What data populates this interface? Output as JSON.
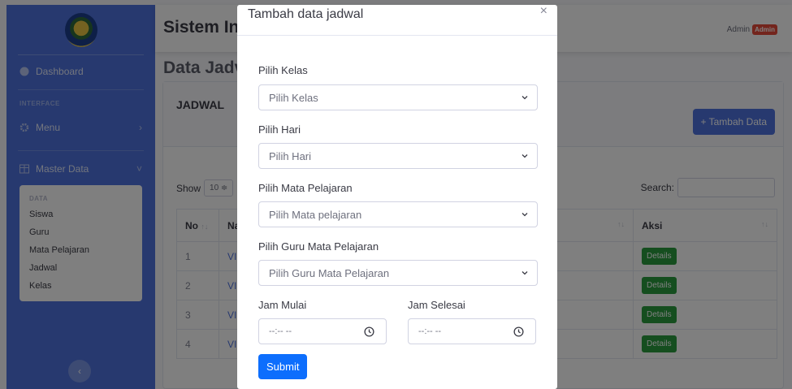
{
  "sidebar": {
    "items": {
      "dashboard": "Dashboard",
      "interface_heading": "INTERFACE",
      "menu": "Menu",
      "master_data": "Master Data",
      "submenu_heading": "DATA",
      "siswa": "Siswa",
      "guru": "Guru",
      "mata_pelajaran": "Mata Pelajaran",
      "jadwal": "Jadwal",
      "kelas": "Kelas"
    },
    "toggle": "‹"
  },
  "topbar": {
    "title": "Sistem In",
    "user": "Admin",
    "badge": "Admin"
  },
  "page": {
    "title": "Data Jadv",
    "card_title": "JADWAL",
    "add_button": "+ Tambah Data",
    "show_label": "Show",
    "show_value": "10 ≑",
    "search_label": "Search:"
  },
  "table": {
    "headers": {
      "no": "No",
      "nama": "Na",
      "aksi": "Aksi"
    },
    "sort_icon": "↑↓",
    "rows": [
      {
        "no": "1",
        "nama": "VI",
        "aksi": "Details"
      },
      {
        "no": "2",
        "nama": "VI",
        "aksi": "Details"
      },
      {
        "no": "3",
        "nama": "VI",
        "aksi": "Details"
      },
      {
        "no": "4",
        "nama": "VI",
        "aksi": "Details"
      }
    ]
  },
  "modal": {
    "title": "Tambah data jadwal",
    "close": "×",
    "fields": {
      "kelas_label": "Pilih Kelas",
      "kelas_placeholder": "Pilih Kelas",
      "hari_label": "Pilih Hari",
      "hari_placeholder": "Pilih Hari",
      "mapel_label": "Pilih Mata Pelajaran",
      "mapel_placeholder": "Pilih Mata pelajaran",
      "guru_label": "Pilih Guru Mata Pelajaran",
      "guru_placeholder": "Pilih Guru Mata Pelajaran",
      "jam_mulai_label": "Jam Mulai",
      "jam_mulai_value": "--:-- --",
      "jam_selesai_label": "Jam Selesai",
      "jam_selesai_value": "--:-- --"
    },
    "submit": "Submit"
  },
  "colors": {
    "sidebar": "#4e73df",
    "primary": "#0d6efd",
    "details": "#2a9d3f",
    "badge": "#e74a3b"
  }
}
